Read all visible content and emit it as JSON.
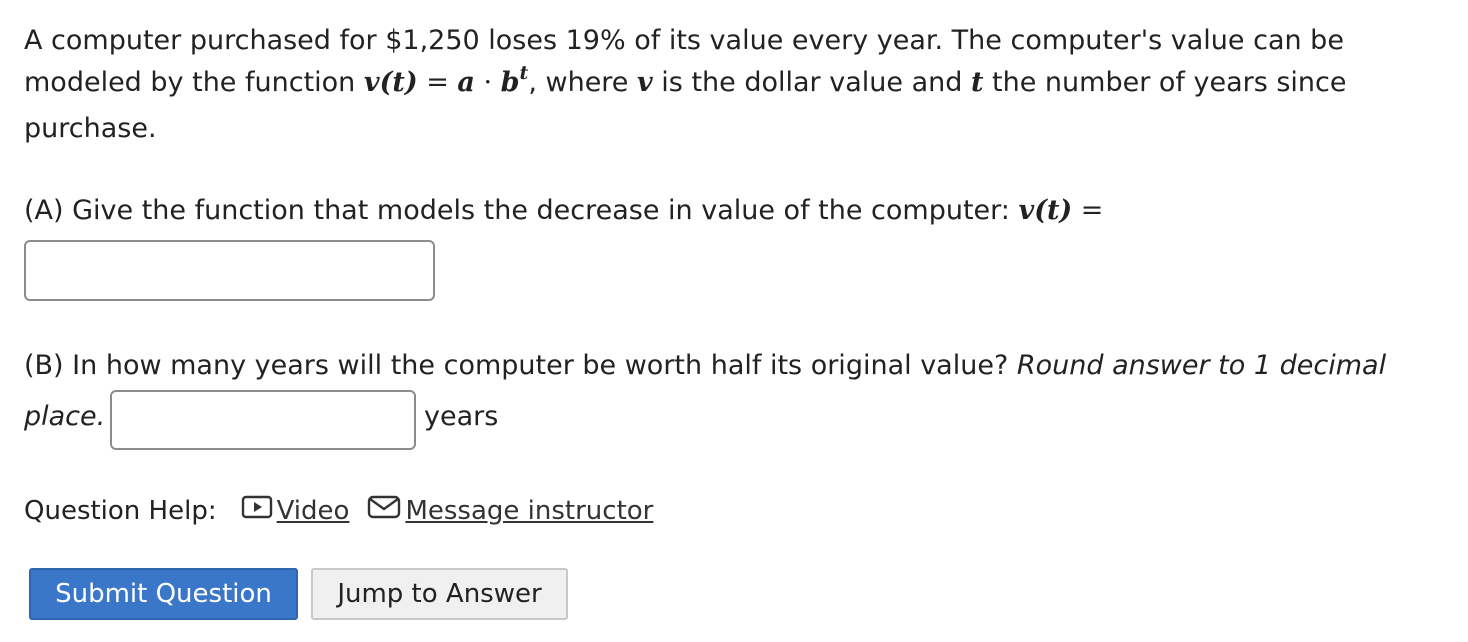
{
  "question": {
    "line1": "A computer purchased for $1,250 loses 19% of its value every year. The computer's value can be",
    "line2_prefix": "modeled by the function ",
    "line2_math_v": "v",
    "line2_math_t_paren": "(t)",
    "line2_math_eq": " = ",
    "line2_math_a": "a",
    "line2_math_dot": " · ",
    "line2_math_b": "b",
    "line2_math_sup_t": "t",
    "line2_mid": ", where ",
    "line2_v": "v",
    "line2_mid2": " is the dollar value and ",
    "line2_t": "t",
    "line2_suffix": " the number of years since",
    "line3": "purchase."
  },
  "partA": {
    "text": "(A) Give the function that models the decrease in value of the computer: ",
    "math_v": "v",
    "math_t_paren": "(t)",
    "math_eq": " =",
    "input_value": ""
  },
  "partB": {
    "text": "(B) In how many years will the computer be worth half its original value? ",
    "italic_text": "Round answer to 1 decimal",
    "italic_text2": "place.",
    "input_value": "",
    "unit_label": "years"
  },
  "help": {
    "label": "Question Help:",
    "video_icon": "play-video-icon",
    "video_label": "Video",
    "message_icon": "envelope-icon",
    "message_label": "Message instructor"
  },
  "buttons": {
    "submit_label": "Submit Question",
    "jump_label": "Jump to Answer"
  },
  "colors": {
    "submit_bg": "#3a77c8",
    "jump_bg": "#f0f0f0",
    "text": "#222222"
  }
}
